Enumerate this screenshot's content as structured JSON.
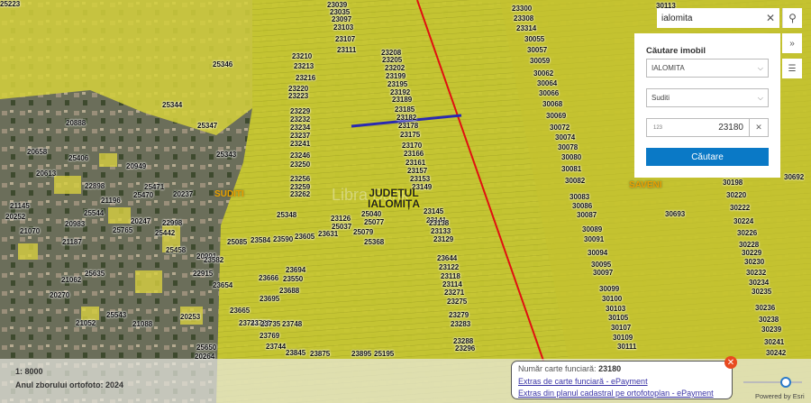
{
  "map": {
    "watermark": "Libra   Bank",
    "county_label": [
      "JUDEȚUL",
      "IALOMIȚA"
    ],
    "areas": [
      "SUDITI",
      "SAVENI"
    ],
    "parcels": [
      "23039",
      "23035",
      "23097",
      "23103",
      "23107",
      "23111",
      "25346",
      "23210",
      "23213",
      "23216",
      "23220",
      "23223",
      "23208",
      "23205",
      "23202",
      "23199",
      "23195",
      "23192",
      "23189",
      "25344",
      "23229",
      "23232",
      "23234",
      "23237",
      "23241",
      "23185",
      "23182",
      "23178",
      "23175",
      "25347",
      "23170",
      "23166",
      "23161",
      "23157",
      "23153",
      "23149",
      "23246",
      "23250",
      "25343",
      "23256",
      "23259",
      "23262",
      "25348",
      "23145",
      "23141",
      "23138",
      "23133",
      "23129",
      "23126",
      "25037",
      "25040",
      "25077",
      "25079",
      "25368",
      "25085",
      "23584",
      "23590",
      "23605",
      "23631",
      "23644",
      "23122",
      "23118",
      "23114",
      "23271",
      "23275",
      "23279",
      "23283",
      "23288",
      "23296",
      "23300",
      "23308",
      "23314",
      "30055",
      "30057",
      "30059",
      "30062",
      "30064",
      "30066",
      "30068",
      "30069",
      "30072",
      "30074",
      "30078",
      "30080",
      "30081",
      "30082",
      "30083",
      "30086",
      "30087",
      "30089",
      "30091",
      "30094",
      "30095",
      "30097",
      "30099",
      "30100",
      "30103",
      "30105",
      "30107",
      "30109",
      "30111",
      "30113",
      "30198",
      "30220",
      "30222",
      "30224",
      "30226",
      "30228",
      "30229",
      "30230",
      "30232",
      "30234",
      "30235",
      "30236",
      "30238",
      "30239",
      "30241",
      "30242",
      "30692",
      "30693",
      "20888",
      "20658",
      "25406",
      "20613",
      "20949",
      "22898",
      "25470",
      "25471",
      "20237",
      "21145",
      "20252",
      "25544",
      "21196",
      "25765",
      "20247",
      "22998",
      "21070",
      "20983",
      "21187",
      "25442",
      "25458",
      "20991",
      "22915",
      "25635",
      "21062",
      "20270",
      "21052",
      "25543",
      "21088",
      "20253",
      "25650",
      "20264",
      "23582",
      "23654",
      "23666",
      "23694",
      "23550",
      "23688",
      "23695",
      "23665",
      "23741",
      "23728",
      "23735",
      "23748",
      "23769",
      "23744",
      "23845",
      "23875",
      "23895",
      "25195",
      "25223"
    ]
  },
  "search": {
    "value": "ialomita",
    "clear_icon": "close-icon",
    "search_icon": "search-icon"
  },
  "side_buttons": {
    "expand_icon": "double-chevron-right-icon",
    "legend_icon": "list-icon",
    "expand": "»",
    "legend": "☰"
  },
  "panel": {
    "title": "Căutare imobil",
    "county": "IALOMITA",
    "locality": "Suditi",
    "number_prefix": "123",
    "number_value": "23180",
    "submit": "Căutare"
  },
  "status": {
    "scale": "1: 8000",
    "ortho_year": "Anul zborului ortofoto: 2024"
  },
  "popup": {
    "label": "Număr carte funciară:",
    "value": "23180",
    "link1": "Extras de carte funciară - ePayment",
    "link2": "Extras din planul cadastral pe ortofotoplan - ePayment"
  },
  "attribution": "Powered by Esri",
  "colors": {
    "parcel_fill": "#d4d43a",
    "boundary": "#e01010",
    "selected_parcel": "#2a2ab0",
    "button": "#0a79c6"
  }
}
